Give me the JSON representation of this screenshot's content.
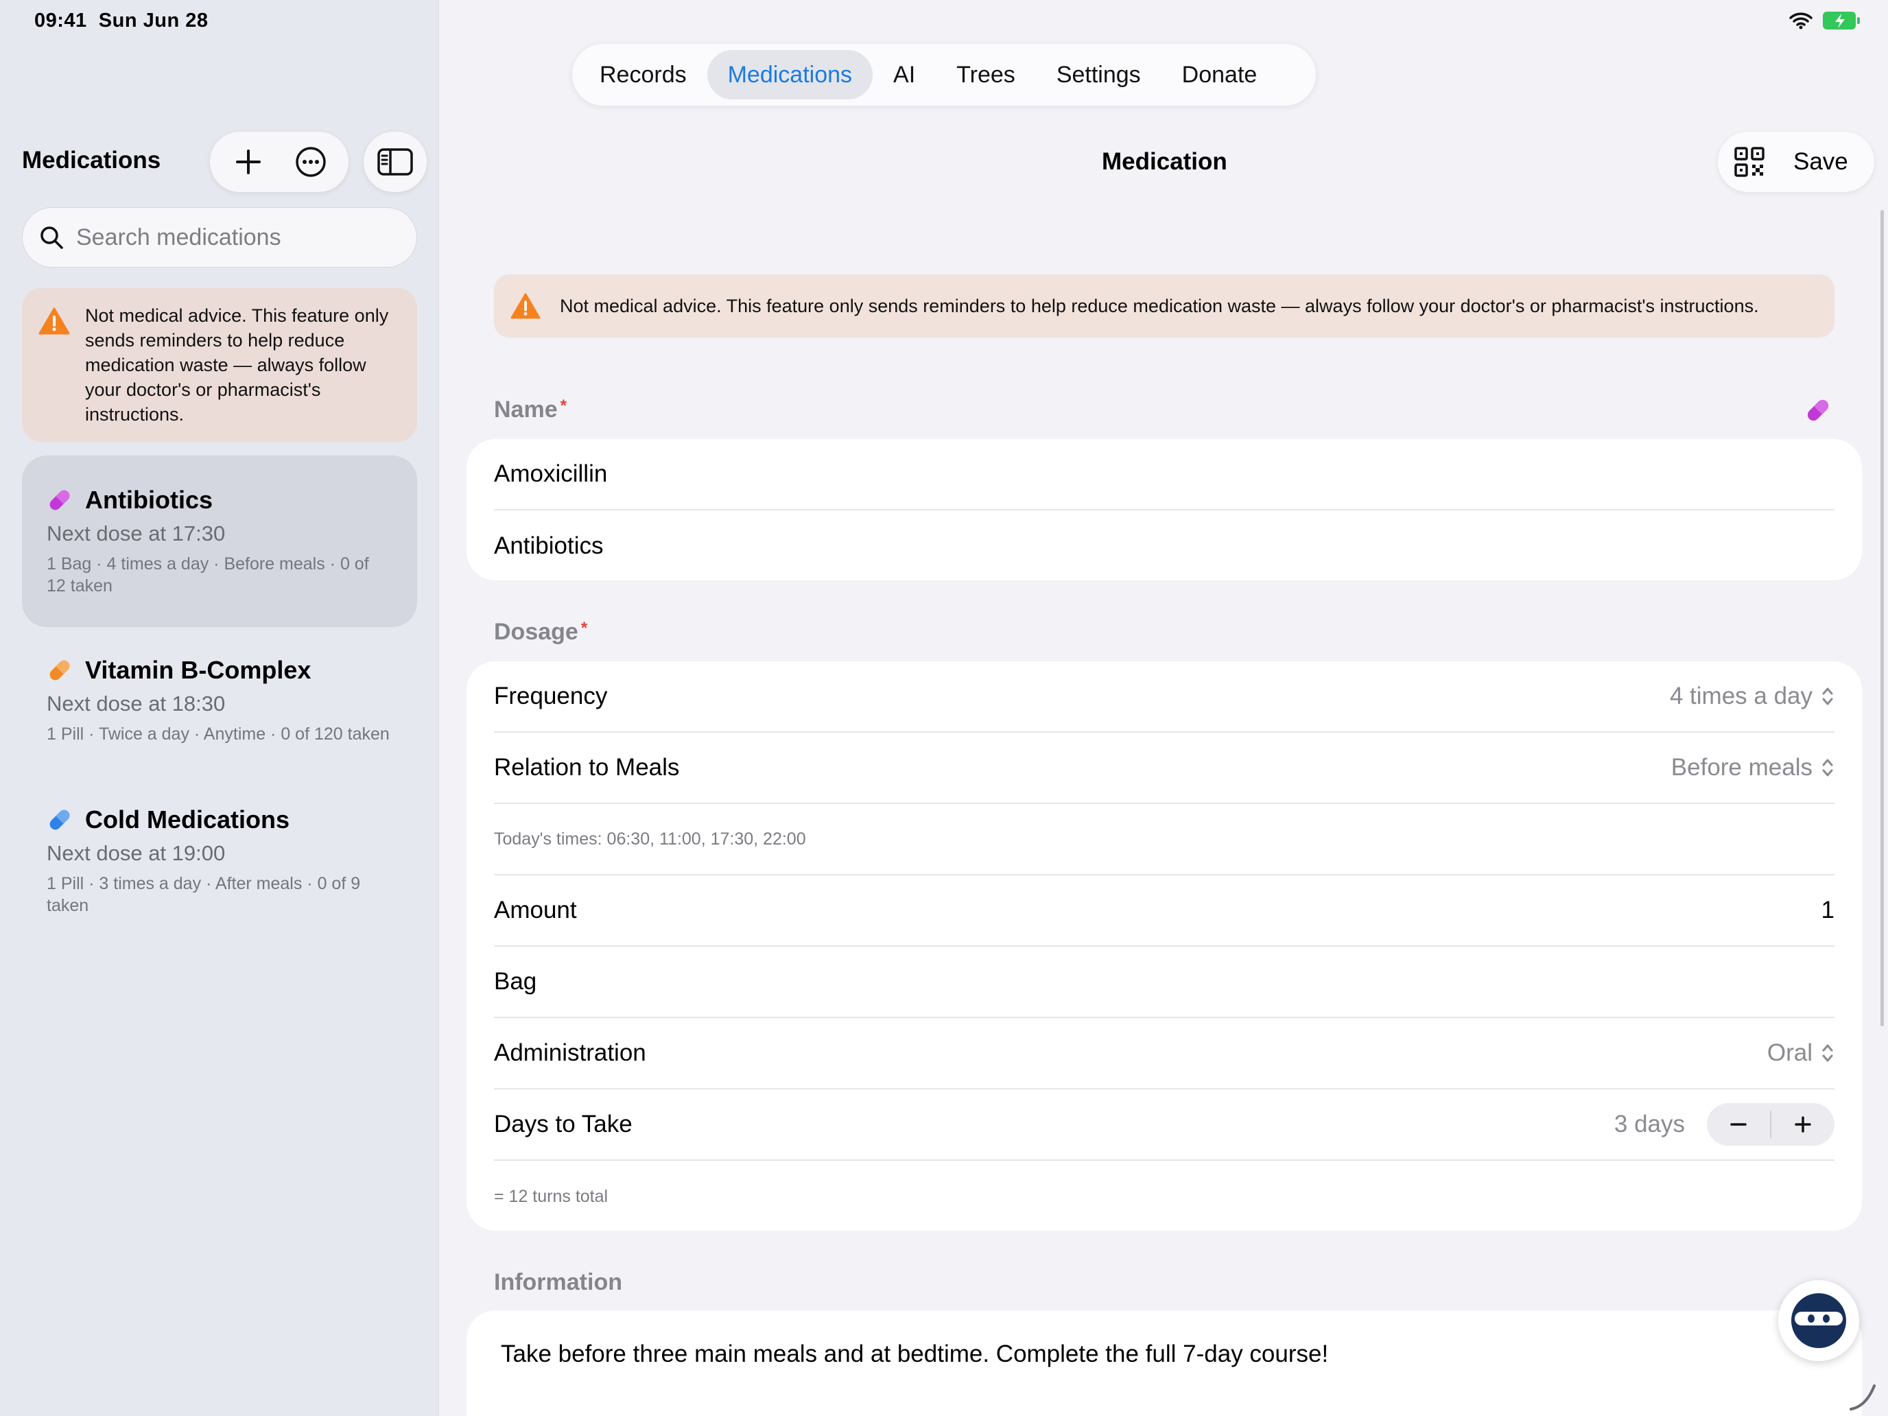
{
  "status_bar": {
    "time": "09:41",
    "date": "Sun Jun 28"
  },
  "sidebar": {
    "title": "Medications",
    "search_placeholder": "Search medications",
    "warning": "Not medical advice. This feature only sends reminders to help reduce medication waste — always follow your doctor's or pharmacist's instructions.",
    "items": [
      {
        "name": "Antibiotics",
        "next": "Next dose at 17:30",
        "meta": "1 Bag · 4 times a day · Before meals · 0 of 12 taken",
        "color": "#c238d6",
        "selected": true
      },
      {
        "name": "Vitamin B-Complex",
        "next": "Next dose at 18:30",
        "meta": "1 Pill · Twice a day · Anytime · 0 of 120 taken",
        "color": "#f08a24",
        "selected": false
      },
      {
        "name": "Cold Medications",
        "next": "Next dose at 19:00",
        "meta": "1 Pill · 3 times a day · After meals · 0 of 9 taken",
        "color": "#2f83e8",
        "selected": false
      }
    ]
  },
  "tabs": [
    {
      "label": "Records",
      "active": false
    },
    {
      "label": "Medications",
      "active": true
    },
    {
      "label": "AI",
      "active": false
    },
    {
      "label": "Trees",
      "active": false
    },
    {
      "label": "Settings",
      "active": false
    },
    {
      "label": "Donate",
      "active": false
    }
  ],
  "main": {
    "title": "Medication",
    "save_label": "Save",
    "banner": "Not medical advice. This feature only sends reminders to help reduce medication waste — always follow your doctor's or pharmacist's instructions.",
    "name_section": {
      "label": "Name",
      "required_mark": "*",
      "name_value": "Amoxicillin",
      "category_value": "Antibiotics",
      "pill_color": "#c238d6"
    },
    "dosage_section": {
      "label": "Dosage",
      "required_mark": "*",
      "frequency_label": "Frequency",
      "frequency_value": "4 times a day",
      "meals_label": "Relation to Meals",
      "meals_value": "Before meals",
      "times_note": "Today's times: 06:30, 11:00, 17:30, 22:00",
      "amount_label": "Amount",
      "amount_value": "1",
      "unit_value": "Bag",
      "admin_label": "Administration",
      "admin_value": "Oral",
      "days_label": "Days to Take",
      "days_value": "3 days",
      "total_note": "= 12 turns total"
    },
    "information_section": {
      "label": "Information",
      "text": "Take before three main meals and at bedtime. Complete the full 7-day course!"
    }
  },
  "colors": {
    "accent": "#1a7ae6",
    "warning": "#f5821f",
    "required": "#e0443a",
    "battery": "#34c759"
  }
}
